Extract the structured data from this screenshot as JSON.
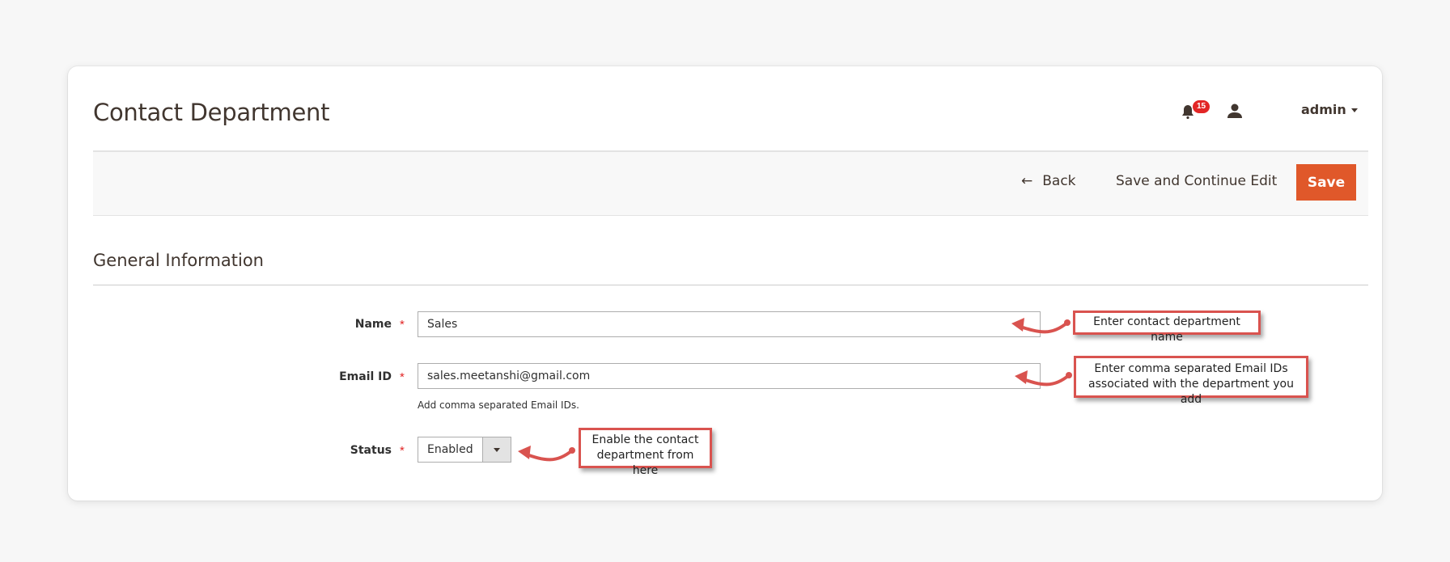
{
  "header": {
    "title": "Contact Department",
    "notifications_count": "15",
    "user_name": "admin",
    "icons": {
      "notifications": "bell-icon",
      "account": "user-icon",
      "menu": "caret-down-icon"
    }
  },
  "toolbar": {
    "back_label": "Back",
    "back_icon": "arrow-left-icon",
    "save_continue_label": "Save and Continue Edit",
    "save_label": "Save",
    "accent_color": "#e0582a"
  },
  "section": {
    "title": "General Information"
  },
  "form": {
    "name": {
      "label": "Name",
      "required_mark": "*",
      "value": "Sales"
    },
    "email": {
      "label": "Email ID",
      "required_mark": "*",
      "value": "sales.meetanshi@gmail.com",
      "note": "Add comma separated Email IDs."
    },
    "status": {
      "label": "Status",
      "required_mark": "*",
      "value": "Enabled"
    }
  },
  "annotations": {
    "name": "Enter contact department name",
    "email_line1": "Enter comma separated Email IDs",
    "email_line2": "associated with the department you add",
    "status_line1": "Enable the contact",
    "status_line2": "department from here",
    "color": "#d9534f"
  }
}
